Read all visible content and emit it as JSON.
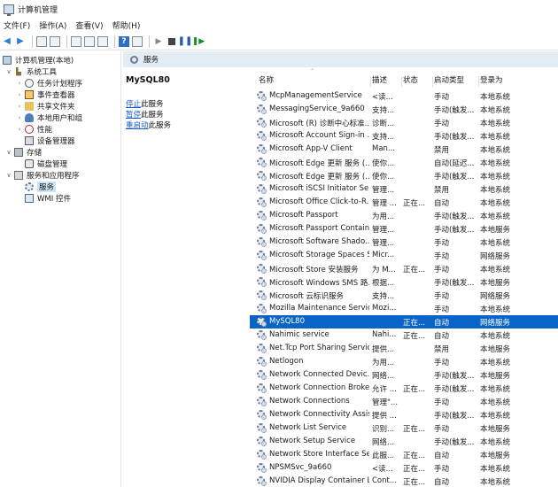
{
  "window": {
    "title": "计算机管理"
  },
  "menu": [
    "文件(F)",
    "操作(A)",
    "查看(V)",
    "帮助(H)"
  ],
  "tree": {
    "root": "计算机管理(本地)",
    "system_tools": "系统工具",
    "task_scheduler": "任务计划程序",
    "event_viewer": "事件查看器",
    "shared_folders": "共享文件夹",
    "local_users": "本地用户和组",
    "performance": "性能",
    "device_manager": "设备管理器",
    "storage": "存储",
    "disk_management": "磁盘管理",
    "services_apps": "服务和应用程序",
    "services": "服务",
    "wmi": "WMI 控件"
  },
  "content": {
    "header": "服务",
    "selected_service": "MySQL80",
    "actions": [
      {
        "link": "停止",
        "suffix": "此服务"
      },
      {
        "link": "暂停",
        "suffix": "此服务"
      },
      {
        "link": "重启动",
        "suffix": "此服务"
      }
    ]
  },
  "columns": {
    "name": "名称",
    "desc": "描述",
    "status": "状态",
    "startup": "启动类型",
    "logon": "登录为"
  },
  "services": [
    {
      "name": "McpManagementService",
      "desc": "<读...",
      "status": "",
      "startup": "手动",
      "logon": "本地系统"
    },
    {
      "name": "MessagingService_9a660",
      "desc": "支持...",
      "status": "",
      "startup": "手动(触发...",
      "logon": "本地系统"
    },
    {
      "name": "Microsoft (R) 诊断中心标准...",
      "desc": "诊断...",
      "status": "",
      "startup": "手动",
      "logon": "本地系统"
    },
    {
      "name": "Microsoft Account Sign-in ...",
      "desc": "支持...",
      "status": "",
      "startup": "手动(触发...",
      "logon": "本地系统"
    },
    {
      "name": "Microsoft App-V Client",
      "desc": "Man...",
      "status": "",
      "startup": "禁用",
      "logon": "本地系统"
    },
    {
      "name": "Microsoft Edge 更新 服务 (...",
      "desc": "使你...",
      "status": "",
      "startup": "自动(延迟...",
      "logon": "本地系统"
    },
    {
      "name": "Microsoft Edge 更新 服务 (...",
      "desc": "使你...",
      "status": "",
      "startup": "手动(触发...",
      "logon": "本地系统"
    },
    {
      "name": "Microsoft iSCSI Initiator Ser...",
      "desc": "管理...",
      "status": "",
      "startup": "禁用",
      "logon": "本地系统"
    },
    {
      "name": "Microsoft Office Click-to-R...",
      "desc": "管理 ...",
      "status": "正在...",
      "startup": "自动",
      "logon": "本地系统"
    },
    {
      "name": "Microsoft Passport",
      "desc": "为用...",
      "status": "",
      "startup": "手动(触发...",
      "logon": "本地系统"
    },
    {
      "name": "Microsoft Passport Container",
      "desc": "管理...",
      "status": "",
      "startup": "手动(触发...",
      "logon": "本地服务"
    },
    {
      "name": "Microsoft Software Shado...",
      "desc": "管理...",
      "status": "",
      "startup": "手动",
      "logon": "本地系统"
    },
    {
      "name": "Microsoft Storage Spaces S...",
      "desc": "Micr...",
      "status": "",
      "startup": "手动",
      "logon": "网络服务"
    },
    {
      "name": "Microsoft Store 安装服务",
      "desc": "为 M...",
      "status": "正在...",
      "startup": "手动",
      "logon": "本地系统"
    },
    {
      "name": "Microsoft Windows SMS 路...",
      "desc": "根据...",
      "status": "",
      "startup": "手动(触发...",
      "logon": "本地服务"
    },
    {
      "name": "Microsoft 云标识服务",
      "desc": "支持...",
      "status": "",
      "startup": "手动",
      "logon": "网络服务"
    },
    {
      "name": "Mozilla Maintenance Service",
      "desc": "Mozi...",
      "status": "",
      "startup": "手动",
      "logon": "本地系统"
    },
    {
      "name": "MySQL80",
      "desc": "",
      "status": "正在...",
      "startup": "自动",
      "logon": "网络服务",
      "selected": true
    },
    {
      "name": "Nahimic service",
      "desc": "Nahi...",
      "status": "正在...",
      "startup": "自动",
      "logon": "本地系统"
    },
    {
      "name": "Net.Tcp Port Sharing Service",
      "desc": "提供...",
      "status": "",
      "startup": "禁用",
      "logon": "本地服务"
    },
    {
      "name": "Netlogon",
      "desc": "为用...",
      "status": "",
      "startup": "手动",
      "logon": "本地系统"
    },
    {
      "name": "Network Connected Devic...",
      "desc": "网络...",
      "status": "",
      "startup": "手动(触发...",
      "logon": "本地服务"
    },
    {
      "name": "Network Connection Broker",
      "desc": "允许 ...",
      "status": "正在...",
      "startup": "手动(触发...",
      "logon": "本地系统"
    },
    {
      "name": "Network Connections",
      "desc": "管理\"...",
      "status": "",
      "startup": "手动",
      "logon": "本地系统"
    },
    {
      "name": "Network Connectivity Assis...",
      "desc": "提供 ...",
      "status": "",
      "startup": "手动(触发...",
      "logon": "本地系统"
    },
    {
      "name": "Network List Service",
      "desc": "识别...",
      "status": "正在...",
      "startup": "手动",
      "logon": "本地服务"
    },
    {
      "name": "Network Setup Service",
      "desc": "网络...",
      "status": "",
      "startup": "手动(触发...",
      "logon": "本地系统"
    },
    {
      "name": "Network Store Interface Se...",
      "desc": "此服...",
      "status": "正在...",
      "startup": "自动",
      "logon": "本地服务"
    },
    {
      "name": "NPSMSvc_9a660",
      "desc": "<读...",
      "status": "正在...",
      "startup": "手动",
      "logon": "本地系统"
    },
    {
      "name": "NVIDIA Display Container LS",
      "desc": "Cont...",
      "status": "正在...",
      "startup": "自动",
      "logon": "本地系统"
    }
  ],
  "icons": {
    "app": "computer-management-icon",
    "service": "gear-icon"
  },
  "colors": {
    "selection": "#0a64c8",
    "header_band": "#e3ecf4",
    "link": "#1a5dc9"
  }
}
